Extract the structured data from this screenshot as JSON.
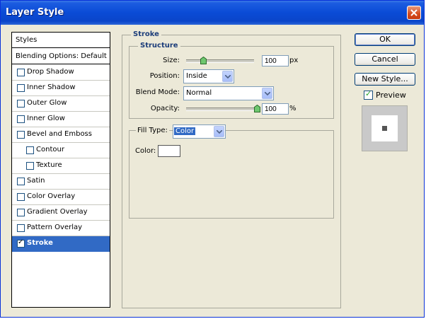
{
  "window": {
    "title": "Layer Style"
  },
  "styles_list": {
    "header": "Styles",
    "blending": "Blending Options: Default",
    "items": [
      {
        "label": "Drop Shadow",
        "checked": false,
        "indent": false
      },
      {
        "label": "Inner Shadow",
        "checked": false,
        "indent": false
      },
      {
        "label": "Outer Glow",
        "checked": false,
        "indent": false
      },
      {
        "label": "Inner Glow",
        "checked": false,
        "indent": false
      },
      {
        "label": "Bevel and Emboss",
        "checked": false,
        "indent": false
      },
      {
        "label": "Contour",
        "checked": false,
        "indent": true
      },
      {
        "label": "Texture",
        "checked": false,
        "indent": true
      },
      {
        "label": "Satin",
        "checked": false,
        "indent": false
      },
      {
        "label": "Color Overlay",
        "checked": false,
        "indent": false
      },
      {
        "label": "Gradient Overlay",
        "checked": false,
        "indent": false
      },
      {
        "label": "Pattern Overlay",
        "checked": false,
        "indent": false
      },
      {
        "label": "Stroke",
        "checked": true,
        "indent": false,
        "selected": true
      }
    ]
  },
  "stroke": {
    "section_title": "Stroke",
    "structure_title": "Structure",
    "size_label": "Size:",
    "size_value": "100",
    "size_unit": "px",
    "size_slider_level": 0.25,
    "position_label": "Position:",
    "position_value": "Inside",
    "blend_mode_label": "Blend Mode:",
    "blend_mode_value": "Normal",
    "opacity_label": "Opacity:",
    "opacity_value": "100",
    "opacity_unit": "%",
    "opacity_slider_level": 1.0,
    "fill_type_label": "Fill Type:",
    "fill_type_value": "Color",
    "color_label": "Color:",
    "color_value": "#ffffff"
  },
  "buttons": {
    "ok": "OK",
    "cancel": "Cancel",
    "new_style": "New Style...",
    "preview": "Preview"
  },
  "colors": {
    "titlebar": "#0a4bd6",
    "selection": "#316ac5",
    "section_title": "#1c3d7a"
  }
}
